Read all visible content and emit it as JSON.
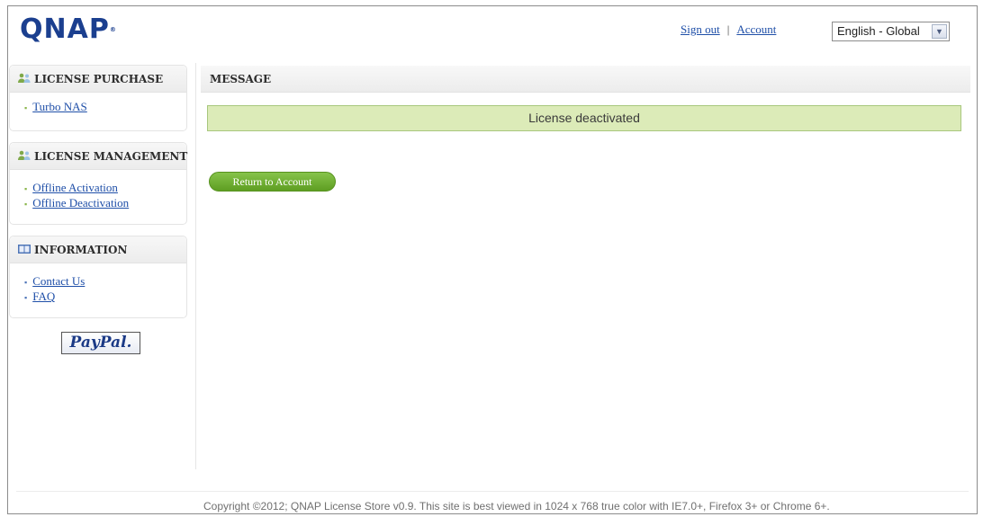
{
  "header": {
    "logo_text": "QNAP",
    "logo_mark": "®",
    "sign_out": "Sign out",
    "separator": "|",
    "account": "Account",
    "language": "English - Global"
  },
  "sidebar": {
    "license_purchase": {
      "title": "LICENSE PURCHASE",
      "icon": "users-icon",
      "links": [
        "Turbo NAS"
      ]
    },
    "license_management": {
      "title": "LICENSE MANAGEMENT",
      "icon": "users-icon",
      "links": [
        "Offline Activation",
        "Offline Deactivation"
      ]
    },
    "information": {
      "title": "INFORMATION",
      "icon": "book-icon",
      "links": [
        "Contact Us",
        "FAQ"
      ]
    },
    "paypal_label": "PayPal."
  },
  "main": {
    "section_title": "MESSAGE",
    "notice": "License deactivated",
    "return_button": "Return to Account"
  },
  "footer": {
    "copyright": "Copyright ©2012; QNAP License Store v0.9. This site is best viewed in 1024 x 768 true color with IE7.0+, Firefox 3+ or Chrome 6+."
  },
  "colors": {
    "brand_blue": "#1b3f8f",
    "link_blue": "#1f4fa8",
    "notice_bg": "#dcebb8",
    "button_green": "#6fae33"
  }
}
